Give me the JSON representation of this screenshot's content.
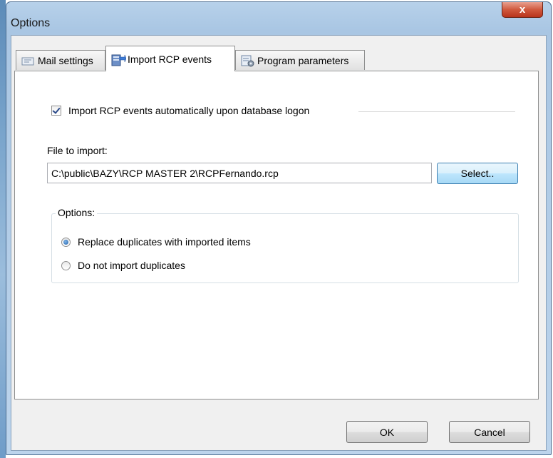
{
  "window": {
    "title": "Options",
    "close_symbol": "x"
  },
  "tabs": [
    {
      "label": "Mail settings",
      "icon": "mail-settings-icon",
      "active": false
    },
    {
      "label": "Import RCP events",
      "icon": "import-events-icon",
      "active": true
    },
    {
      "label": "Program parameters",
      "icon": "program-parameters-icon",
      "active": false
    }
  ],
  "import": {
    "auto_import_label": "Import RCP events automatically upon database logon",
    "auto_import_checked": true,
    "file_label": "File to import:",
    "file_path": "C:\\public\\BAZY\\RCP MASTER 2\\RCPFernando.rcp",
    "select_button": "Select.."
  },
  "options": {
    "legend": "Options:",
    "radios": [
      {
        "label": "Replace duplicates with imported items",
        "selected": true
      },
      {
        "label": "Do not import duplicates",
        "selected": false
      }
    ]
  },
  "footer": {
    "ok": "OK",
    "cancel": "Cancel"
  },
  "colors": {
    "title_bar": "#a9c6e3",
    "close": "#d0593e",
    "accent": "#3c7fb1"
  }
}
